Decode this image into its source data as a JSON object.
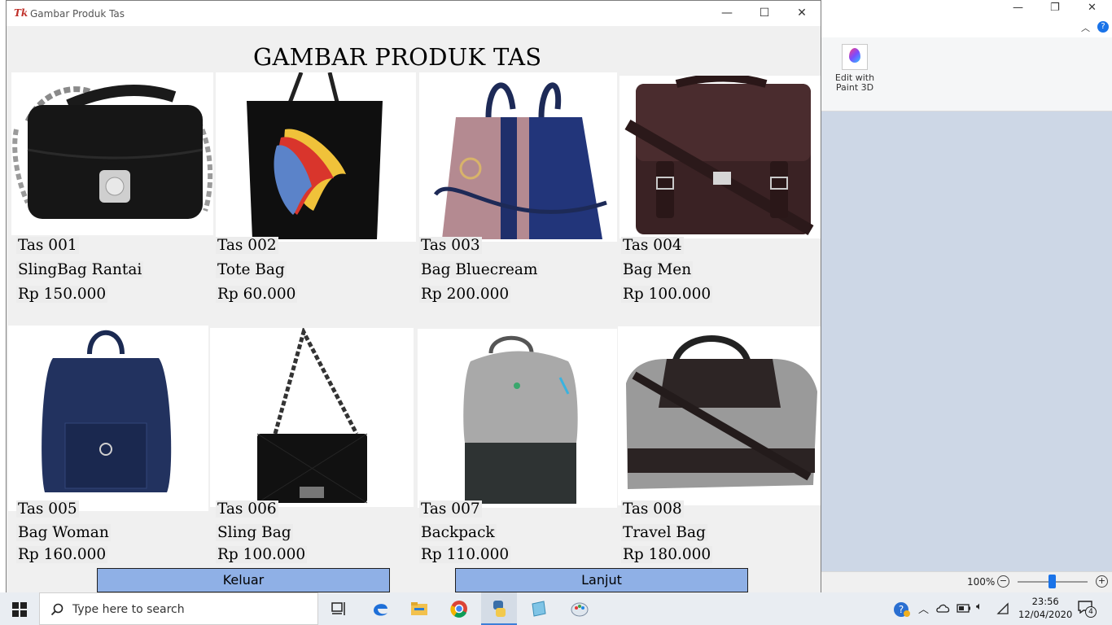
{
  "window": {
    "title": "Gambar Produk Tas",
    "heading": "GAMBAR PRODUK TAS",
    "controls": {
      "minimize": "—",
      "maximize": "☐",
      "close": "✕"
    }
  },
  "products": [
    {
      "code": "Tas 001",
      "name": "SlingBag Rantai",
      "price": "Rp 150.000"
    },
    {
      "code": "Tas 002",
      "name": "Tote Bag",
      "price": "Rp 60.000"
    },
    {
      "code": "Tas 003",
      "name": "Bag Bluecream",
      "price": "Rp 200.000"
    },
    {
      "code": "Tas 004",
      "name": "Bag Men",
      "price": "Rp 100.000"
    },
    {
      "code": "Tas 005",
      "name": "Bag Woman",
      "price": "Rp 160.000"
    },
    {
      "code": "Tas 006",
      "name": "Sling Bag",
      "price": "Rp 100.000"
    },
    {
      "code": "Tas 007",
      "name": "Backpack",
      "price": "Rp 110.000"
    },
    {
      "code": "Tas 008",
      "name": "Travel Bag",
      "price": "Rp 180.000"
    }
  ],
  "buttons": {
    "exit": "Keluar",
    "next": "Lanjut"
  },
  "background_app": {
    "paint3d_label": "Edit with Paint 3D",
    "zoom": "100%"
  },
  "taskbar": {
    "search_placeholder": "Type here to search",
    "time": "23:56",
    "date": "12/04/2020",
    "notifications": "4"
  }
}
